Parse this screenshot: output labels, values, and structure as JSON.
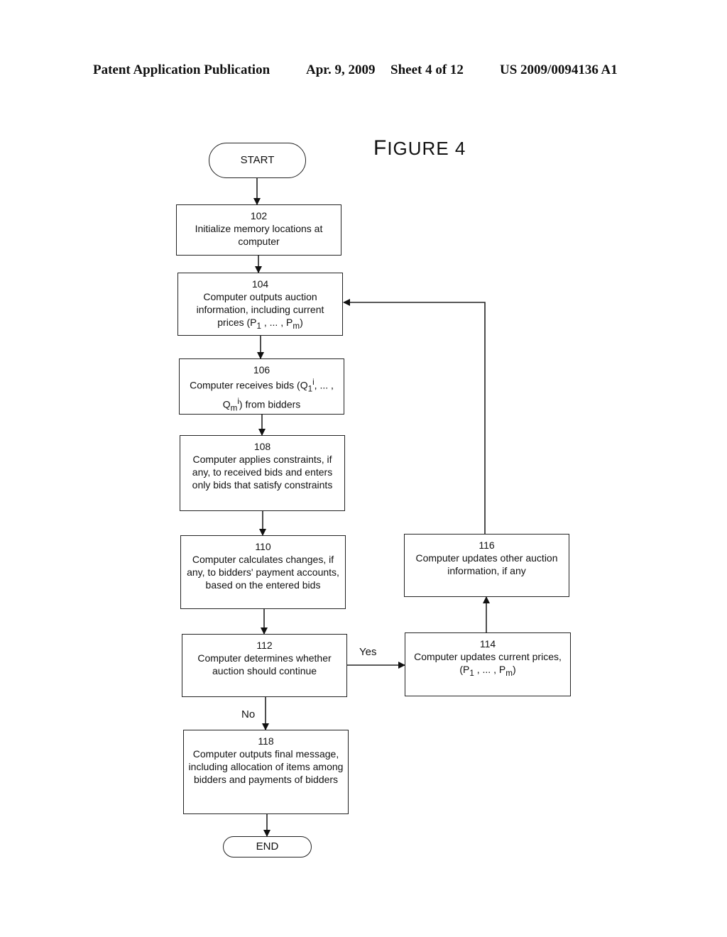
{
  "header": {
    "publication": "Patent Application Publication",
    "date": "Apr. 9, 2009",
    "sheet": "Sheet 4 of 12",
    "number": "US 2009/0094136 A1"
  },
  "figure": {
    "title_first": "F",
    "title_rest": "IGURE 4"
  },
  "nodes": {
    "start": {
      "label": "START"
    },
    "n102": {
      "num": "102",
      "text": "Initialize memory locations at computer"
    },
    "n104": {
      "num": "104",
      "text": "Computer outputs auction information, including current prices (P",
      "sub1": "1",
      "mid": " , ... , P",
      "sub2": "m",
      "end": ")"
    },
    "n106": {
      "num": "106",
      "text": "Computer receives bids (Q",
      "sub1": "1",
      "sup1": "i",
      "mid": ", ... , Q",
      "sub2": "m",
      "sup2": "i",
      "end": ") from bidders"
    },
    "n108": {
      "num": "108",
      "text": "Computer applies constraints, if any, to received bids and enters only bids that satisfy constraints"
    },
    "n110": {
      "num": "110",
      "text": "Computer calculates changes, if any, to bidders' payment accounts, based on the entered bids"
    },
    "n112": {
      "num": "112",
      "text": "Computer determines whether auction should continue"
    },
    "n114": {
      "num": "114",
      "text": "Computer updates current prices, (P",
      "sub1": "1",
      "mid": " , ... , P",
      "sub2": "m",
      "end": ")"
    },
    "n116": {
      "num": "116",
      "text": "Computer updates other auction information, if any"
    },
    "n118": {
      "num": "118",
      "text": "Computer outputs final message, including allocation of items among bidders and payments of bidders"
    },
    "end": {
      "label": "END"
    }
  },
  "edges": {
    "yes_label": "Yes",
    "no_label": "No"
  }
}
